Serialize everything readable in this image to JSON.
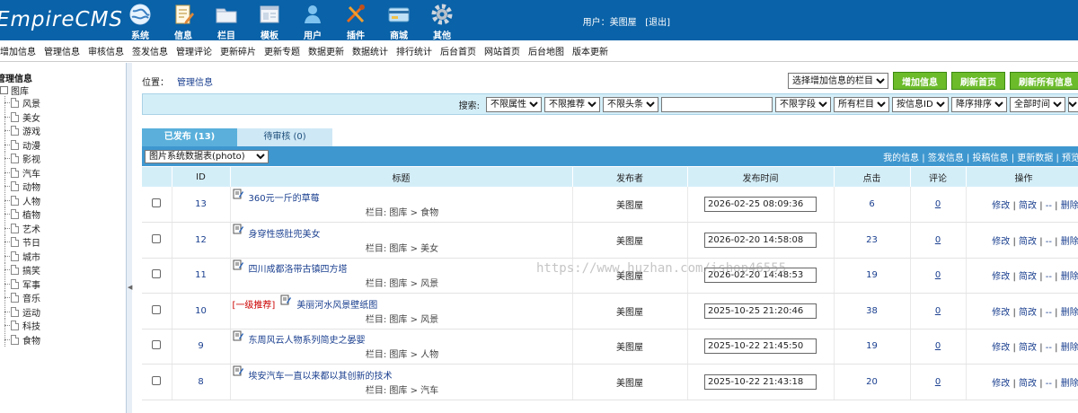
{
  "app": {
    "logo_text": "EmpireCMS"
  },
  "topnav": [
    {
      "label": "系统",
      "icon": "globe-icon"
    },
    {
      "label": "信息",
      "icon": "edit-doc-icon"
    },
    {
      "label": "栏目",
      "icon": "folder-icon"
    },
    {
      "label": "模板",
      "icon": "template-icon"
    },
    {
      "label": "用户",
      "icon": "user-icon"
    },
    {
      "label": "插件",
      "icon": "tools-icon"
    },
    {
      "label": "商城",
      "icon": "card-icon"
    },
    {
      "label": "其他",
      "icon": "gear-icon"
    }
  ],
  "user": {
    "label": "用户：美图屋",
    "logout": "[退出]"
  },
  "menu": [
    "增加信息",
    "管理信息",
    "审核信息",
    "签发信息",
    "管理评论",
    "更新碎片",
    "更新专题",
    "数据更新",
    "数据统计",
    "排行统计",
    "后台首页",
    "网站首页",
    "后台地图",
    "版本更新"
  ],
  "tree": {
    "title": "管理信息",
    "root": "图库",
    "items": [
      "风景",
      "美女",
      "游戏",
      "动漫",
      "影视",
      "汽车",
      "动物",
      "人物",
      "植物",
      "艺术",
      "节日",
      "城市",
      "搞笑",
      "军事",
      "音乐",
      "运动",
      "科技",
      "食物"
    ]
  },
  "location": {
    "label": "位置：",
    "link": "管理信息"
  },
  "actions": {
    "column_select": "选择增加信息的栏目",
    "add_info": "增加信息",
    "refresh_home": "刷新首页",
    "refresh_all": "刷新所有信息"
  },
  "search": {
    "label": "搜索:",
    "filters": [
      "不限属性",
      "不限推荐",
      "不限头条"
    ],
    "keyword_value": "",
    "field": "不限字段",
    "columns": "所有栏目",
    "order_by": "按信息ID",
    "direction": "降序排序",
    "time": "全部时间",
    "submit": "搜"
  },
  "tabs": {
    "published": "已发布 (13)",
    "pending": "待审核 (0)"
  },
  "list": {
    "table_select": "图片系统数据表(photo)",
    "links": "我的信息 | 签发信息 | 投稿信息 | 更新数据 | 预览"
  },
  "table": {
    "headers": [
      "",
      "ID",
      "标题",
      "发布者",
      "发布时间",
      "点击",
      "评论",
      "操作"
    ],
    "category_prefix": "栏目: ",
    "rows": [
      {
        "id": "13",
        "recommend": "",
        "title": "360元一斤的草莓",
        "category": "图库 > 食物",
        "publisher": "美图屋",
        "time": "2026-02-25 08:09:36",
        "clicks": "6",
        "comments": "0"
      },
      {
        "id": "12",
        "recommend": "",
        "title": "身穿性感肚兜美女",
        "category": "图库 > 美女",
        "publisher": "美图屋",
        "time": "2026-02-20 14:58:08",
        "clicks": "23",
        "comments": "0"
      },
      {
        "id": "11",
        "recommend": "",
        "title": "四川成都洛带古镇四方塔",
        "category": "图库 > 风景",
        "publisher": "美图屋",
        "time": "2026-02-20 14:48:53",
        "clicks": "19",
        "comments": "0"
      },
      {
        "id": "10",
        "recommend": "[一级推荐]",
        "title": "美丽河水风景壁纸图",
        "category": "图库 > 风景",
        "publisher": "美图屋",
        "time": "2025-10-25 21:20:46",
        "clicks": "38",
        "comments": "0"
      },
      {
        "id": "9",
        "recommend": "",
        "title": "东周风云人物系列简史之晏婴",
        "category": "图库 > 人物",
        "publisher": "美图屋",
        "time": "2025-10-22 21:45:50",
        "clicks": "19",
        "comments": "0"
      },
      {
        "id": "8",
        "recommend": "",
        "title": "埃安汽车一直以来都以其创新的技术",
        "category": "图库 > 汽车",
        "publisher": "美图屋",
        "time": "2025-10-22 21:43:18",
        "clicks": "20",
        "comments": "0"
      }
    ],
    "ops": {
      "edit": "修改",
      "quick_edit": "简改",
      "dash": "--",
      "delete": "删除"
    }
  },
  "watermark": "https://www.huzhan.com/ishop46555"
}
